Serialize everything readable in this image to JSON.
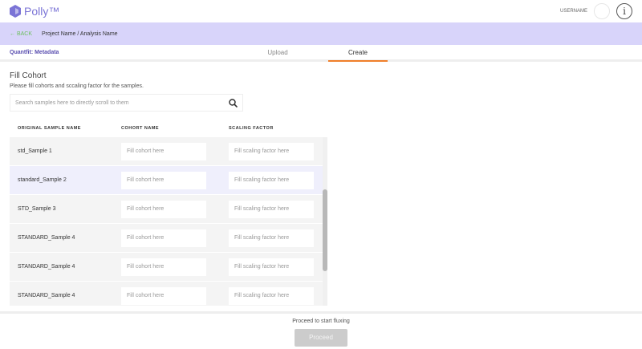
{
  "app": {
    "name": "Polly™",
    "username": "USERNAME"
  },
  "nav": {
    "back": "← BACK",
    "breadcrumb": "Project Name / Analysis Name"
  },
  "subheader": {
    "title": "Quantfit: Metadata",
    "tabs": [
      {
        "label": "Upload",
        "active": false
      },
      {
        "label": "Create",
        "active": true
      }
    ]
  },
  "main": {
    "title": "Fill Cohort",
    "description": "Please fill cohorts and sccaling factor for the samples.",
    "search_placeholder": "Search samples here to directly scroll to them",
    "columns": [
      "ORIGINAL SAMPLE NAME",
      "COHORT NAME",
      "SCALING FACTOR"
    ],
    "cohort_placeholder": "Fill cohort here",
    "scaling_placeholder": "Fill scaling factor here",
    "rows": [
      {
        "name": "std_Sample 1"
      },
      {
        "name": "standard_Sample 2"
      },
      {
        "name": "STD_Sample 3"
      },
      {
        "name": "STANDARD_Sample 4"
      },
      {
        "name": "STANDARD_Sample 4"
      },
      {
        "name": "STANDARD_Sample 4"
      }
    ]
  },
  "footer": {
    "hint": "Proceed to start fluxing",
    "button": "Proceed"
  },
  "colors": {
    "brand": "#7b74d6",
    "accent": "#f07f2a",
    "nav_bg": "#d8d4fa"
  }
}
